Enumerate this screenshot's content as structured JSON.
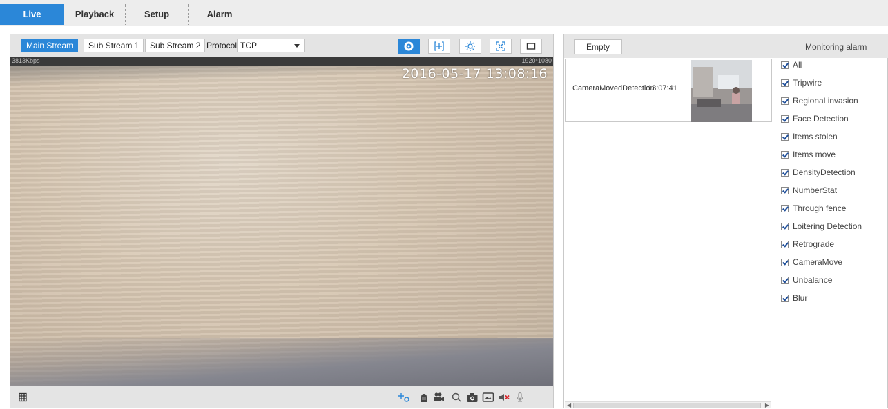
{
  "nav": {
    "tabs": [
      {
        "label": "Live",
        "active": true
      },
      {
        "label": "Playback",
        "active": false
      },
      {
        "label": "Setup",
        "active": false
      },
      {
        "label": "Alarm",
        "active": false
      }
    ]
  },
  "stream_bar": {
    "main_stream": "Main Stream",
    "sub_stream_1": "Sub Stream 1",
    "sub_stream_2": "Sub Stream 2",
    "protocol_label": "Protocol",
    "protocol_value": "TCP"
  },
  "video": {
    "bitrate": "3813Kbps",
    "resolution": "1920*1080",
    "timestamp": "2016-05-17 13:08:16"
  },
  "toolbar_icons": [
    "fisheye-icon",
    "zoom-region-icon",
    "image-adjust-icon",
    "fit-screen-icon",
    "window-icon"
  ],
  "bottom_icons": [
    "ptz-icon",
    "alarm-bell-icon",
    "record-icon",
    "zoom-search-icon",
    "snapshot-icon",
    "image-icon",
    "audio-mute-icon",
    "microphone-icon"
  ],
  "alarm": {
    "empty_label": "Empty",
    "title": "Monitoring alarm",
    "entries": [
      {
        "name": "CameraMovedDetection",
        "time": "13:07:41"
      }
    ],
    "filters": [
      {
        "label": "All",
        "checked": true
      },
      {
        "label": "Tripwire",
        "checked": true
      },
      {
        "label": "Regional invasion",
        "checked": true
      },
      {
        "label": "Face Detection",
        "checked": true
      },
      {
        "label": "Items stolen",
        "checked": true
      },
      {
        "label": "Items move",
        "checked": true
      },
      {
        "label": "DensityDetection",
        "checked": true
      },
      {
        "label": "NumberStat",
        "checked": true
      },
      {
        "label": "Through fence",
        "checked": true
      },
      {
        "label": "Loitering Detection",
        "checked": true
      },
      {
        "label": "Retrograde",
        "checked": true
      },
      {
        "label": "CameraMove",
        "checked": true
      },
      {
        "label": "Unbalance",
        "checked": true
      },
      {
        "label": "Blur",
        "checked": true
      }
    ]
  },
  "colors": {
    "accent": "#2b87d8",
    "toolbar_bg": "#e4e4e4"
  }
}
